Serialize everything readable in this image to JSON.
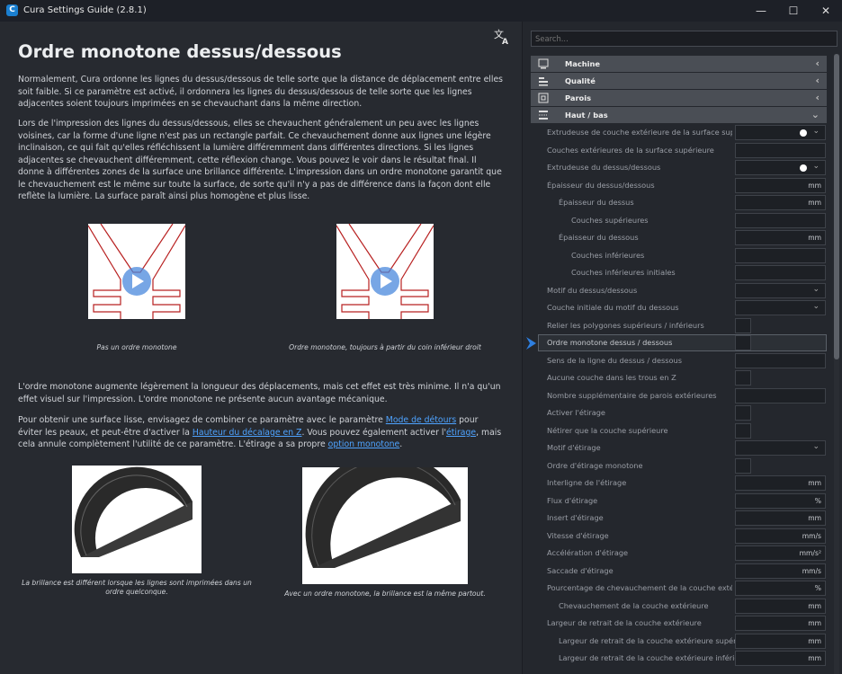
{
  "window": {
    "title": "Cura Settings Guide (2.8.1)",
    "icon_letter": "C",
    "minimize": "—",
    "maximize": "☐",
    "close": "✕"
  },
  "article": {
    "title": "Ordre monotone dessus/dessous",
    "para1": "Normalement, Cura ordonne les lignes du dessus/dessous de telle sorte que la distance de déplacement entre elles soit faible. Si ce paramètre est activé, il ordonnera les lignes du dessus/dessous de telle sorte que les lignes adjacentes soient toujours imprimées en se chevauchant dans la même direction.",
    "para2": "Lors de l'impression des lignes du dessus/dessous, elles se chevauchent généralement un peu avec les lignes voisines, car la forme d'une ligne n'est pas un rectangle parfait. Ce chevauchement donne aux lignes une légère inclinaison, ce qui fait qu'elles réfléchissent la lumière différemment dans différentes directions. Si les lignes adjacentes se chevauchent différemment, cette réflexion change. Vous pouvez le voir dans le résultat final. Il donne à différentes zones de la surface une brillance différente. L'impression dans un ordre monotone garantit que le chevauchement est le même sur toute la surface, de sorte qu'il n'y a pas de différence dans la façon dont elle reflète la lumière. La surface paraît ainsi plus homogène et plus lisse.",
    "caption1": "Pas un ordre monotone",
    "caption2": "Ordre monotone, toujours à partir du coin inférieur droit",
    "para3": "L'ordre monotone augmente légèrement la longueur des déplacements, mais cet effet est très minime. Il n'a qu'un effet visuel sur l'impression. L'ordre monotone ne présente aucun avantage mécanique.",
    "para4_a": "Pour obtenir une surface lisse, envisagez de combiner ce paramètre avec le paramètre ",
    "para4_link1": "Mode de détours",
    "para4_b": " pour éviter les peaux, et peut-être d'activer la ",
    "para4_link2": "Hauteur du décalage en Z",
    "para4_c": ". Vous pouvez également activer l'",
    "para4_link3": "étirage",
    "para4_d": ", mais cela annule complètement l'utilité de ce paramètre. L'étirage a sa propre ",
    "para4_link4": "option monotone",
    "para4_e": ".",
    "caption3": "La brillance est différent lorsque les lignes sont imprimées dans un ordre quelconque.",
    "caption4": "Avec un ordre monotone, la brillance est la même partout."
  },
  "sidebar": {
    "search_placeholder": "Search...",
    "categories": [
      {
        "label": "Machine",
        "chevron": "‹"
      },
      {
        "label": "Qualité",
        "chevron": "‹"
      },
      {
        "label": "Parois",
        "chevron": "‹"
      },
      {
        "label": "Haut / bas",
        "chevron": "⌄"
      }
    ],
    "settings": [
      {
        "label": "Extrudeuse de couche extérieure de la surface supérieure",
        "unit": ""
      },
      {
        "label": "Couches extérieures de la surface supérieure",
        "unit": ""
      },
      {
        "label": "Extrudeuse du dessus/dessous",
        "unit": ""
      },
      {
        "label": "Épaisseur du dessus/dessous",
        "unit": "mm"
      },
      {
        "label": "Épaisseur du dessus",
        "unit": "mm"
      },
      {
        "label": "Couches supérieures",
        "unit": ""
      },
      {
        "label": "Épaisseur du dessous",
        "unit": "mm"
      },
      {
        "label": "Couches inférieures",
        "unit": ""
      },
      {
        "label": "Couches inférieures initiales",
        "unit": ""
      },
      {
        "label": "Motif du dessus/dessous",
        "unit": ""
      },
      {
        "label": "Couche initiale du motif du dessous",
        "unit": ""
      },
      {
        "label": "Relier les polygones supérieurs / inférieurs",
        "unit": ""
      },
      {
        "label": "Ordre monotone dessus / dessous",
        "unit": ""
      },
      {
        "label": "Sens de la ligne du dessus / dessous",
        "unit": ""
      },
      {
        "label": "Aucune couche dans les trous en Z",
        "unit": ""
      },
      {
        "label": "Nombre supplémentaire de parois extérieures",
        "unit": ""
      },
      {
        "label": "Activer l'étirage",
        "unit": ""
      },
      {
        "label": "Nétirer que la couche supérieure",
        "unit": ""
      },
      {
        "label": "Motif d'étirage",
        "unit": ""
      },
      {
        "label": "Ordre d'étirage monotone",
        "unit": ""
      },
      {
        "label": "Interligne de l'étirage",
        "unit": "mm"
      },
      {
        "label": "Flux d'étirage",
        "unit": "%"
      },
      {
        "label": "Insert d'étirage",
        "unit": "mm"
      },
      {
        "label": "Vitesse d'étirage",
        "unit": "mm/s"
      },
      {
        "label": "Accélération d'étirage",
        "unit": "mm/s²"
      },
      {
        "label": "Saccade d'étirage",
        "unit": "mm/s"
      },
      {
        "label": "Pourcentage de chevauchement de la couche extérieure",
        "unit": "%"
      },
      {
        "label": "Chevauchement de la couche extérieure",
        "unit": "mm"
      },
      {
        "label": "Largeur de retrait de la couche extérieure",
        "unit": "mm"
      },
      {
        "label": "Largeur de retrait de la couche extérieure supérieure",
        "unit": "mm"
      },
      {
        "label": "Largeur de retrait de la couche extérieure inférieure",
        "unit": "mm"
      }
    ]
  }
}
